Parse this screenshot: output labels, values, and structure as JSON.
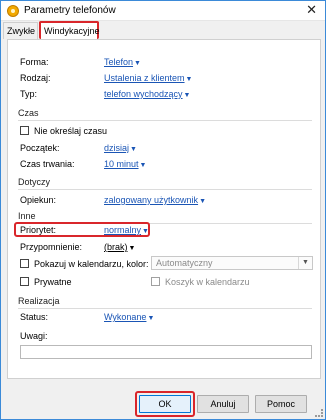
{
  "window": {
    "title": "Parametry telefonów"
  },
  "tabs": [
    {
      "label": "Zwykłe"
    },
    {
      "label": "Windykacyjne"
    }
  ],
  "fields": {
    "forma": {
      "label": "Forma:",
      "value": "Telefon"
    },
    "rodzaj": {
      "label": "Rodzaj:",
      "value": "Ustalenia z klientem"
    },
    "typ": {
      "label": "Typ:",
      "value": "telefon wychodzący"
    }
  },
  "sections": {
    "czas": "Czas",
    "dotyczy": "Dotyczy",
    "inne": "Inne",
    "realizacja": "Realizacja"
  },
  "czas": {
    "no_time_label": "Nie określaj czasu",
    "start_label": "Początek:",
    "start_value": "dzisiaj",
    "duration_label": "Czas trwania:",
    "duration_value": "10 minut"
  },
  "dotyczy": {
    "opiekun_label": "Opiekun:",
    "opiekun_value": "zalogowany użytkownik"
  },
  "inne": {
    "priority_label": "Priorytet:",
    "priority_value": "normalny",
    "reminder_label": "Przypomnienie:",
    "reminder_value": "(brak)",
    "show_calendar_label": "Pokazuj w kalendarzu, kolor:",
    "color_value": "Automatyczny",
    "private_label": "Prywatne",
    "basket_label": "Koszyk w kalendarzu"
  },
  "realizacja": {
    "status_label": "Status:",
    "status_value": "Wykonane",
    "notes_label": "Uwagi:",
    "notes_value": ""
  },
  "buttons": {
    "ok": "OK",
    "cancel": "Anuluj",
    "help": "Pomoc"
  },
  "colors": {
    "link": "#1a55b5",
    "highlight": "#d9262b",
    "window_border": "#3b8ad8"
  },
  "icons": {
    "app": "phone-params-app-icon",
    "close": "close-icon"
  }
}
